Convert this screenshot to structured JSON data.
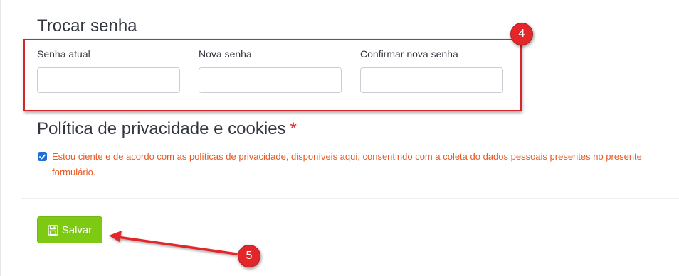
{
  "password_section": {
    "title": "Trocar senha",
    "fields": [
      {
        "label": "Senha atual",
        "value": ""
      },
      {
        "label": "Nova senha",
        "value": ""
      },
      {
        "label": "Confirmar nova senha",
        "value": ""
      }
    ],
    "annotation_number": "4"
  },
  "privacy_section": {
    "title": "Política de privacidade e cookies",
    "required_mark": "*",
    "consent_checked": true,
    "consent_text": "Estou ciente e de acordo com as políticas de privacidade, disponíveis aqui, consentindo com a coleta do dados pessoais presentes no presente formulário."
  },
  "actions": {
    "save_label": "Salvar",
    "save_icon": "floppy-disk-icon",
    "annotation_number": "5"
  },
  "colors": {
    "accent_red": "#e2262a",
    "save_green": "#7dc914",
    "consent_orange": "#ea5a22",
    "checkbox_blue": "#1e6fd9"
  }
}
